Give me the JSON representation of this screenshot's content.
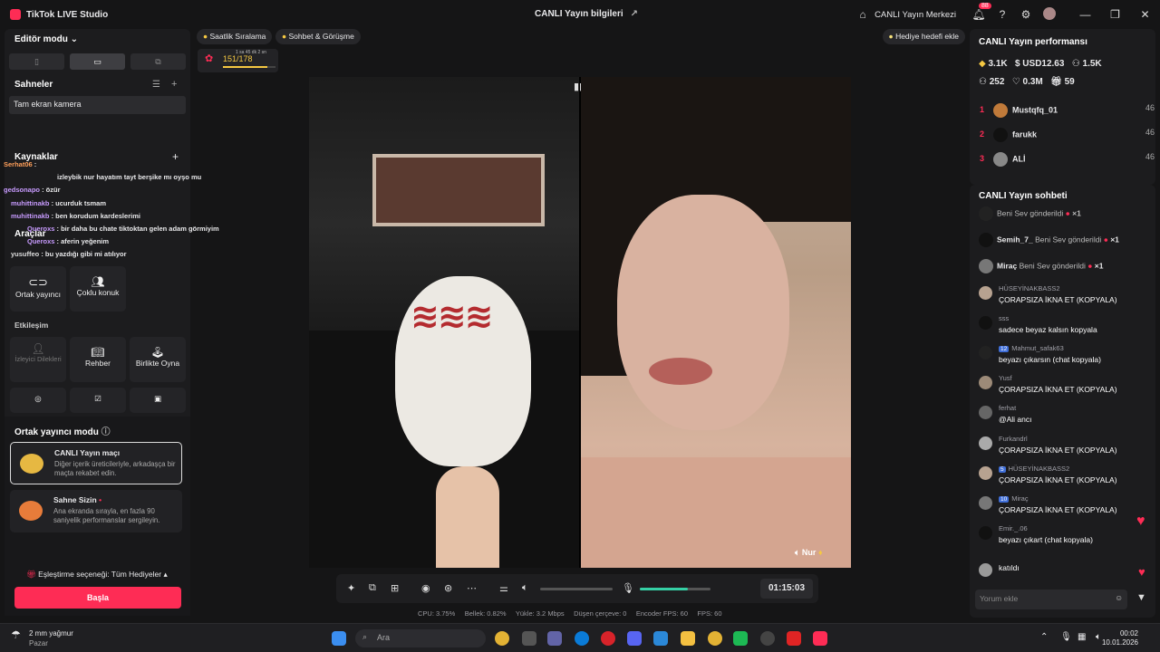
{
  "titlebar": {
    "app_title": "TikTok LIVE Studio",
    "center_title": "CANLI Yayın bilgileri",
    "live_center": "CANLI Yayın Merkezi",
    "notif_count": "88"
  },
  "left": {
    "editor_mode": "Editör modu",
    "scenes_title": "Sahneler",
    "scene_item": "Tam ekran kamera",
    "sources_title": "Kaynaklar",
    "tools_title": "Araçlar",
    "tools": [
      "Ortak yayıncı",
      "Çoklu konuk"
    ],
    "interaction_title": "Etkileşim",
    "interaction": [
      "İzleyici Dilekleri",
      "Rehber",
      "Birlikte Oyna"
    ],
    "overlay_chat": [
      {
        "u": "Serhat06",
        "t": " :  "
      },
      {
        "u": "",
        "t": "izleybik nur hayatım tayt berşike mı oyşo mu"
      },
      {
        "u": "gedsonapo",
        "t": " : özür"
      },
      {
        "u": "muhittinakb",
        "t": " : ucurduk tsmam"
      },
      {
        "u": "muhittinakb",
        "t": " : ben korudum kardeslerimi"
      },
      {
        "u": "Queroxs",
        "t": " : bir daha bu chate tiktoktan gelen adam görmiyim"
      },
      {
        "u": "Queroxs",
        "t": " : aferin yeğenim"
      },
      {
        "u": "yusuffeo",
        "t": " : bu yazdığı gibi mi atılıyor"
      }
    ],
    "cohost_title": "Ortak yayıncı modu",
    "cards": [
      {
        "title": "CANLI Yayın maçı",
        "desc": "Diğer içerik üreticileriyle, arkadaşça bir maçta rekabet edin."
      },
      {
        "title": "Sahne Sizin",
        "desc": "Ana ekranda sırayla, en fazla 90 saniyelik performanslar sergileyin."
      }
    ],
    "match_option": "Eşleştirme seçeneği: Tüm Hediyeler",
    "start_button": "Başla"
  },
  "center": {
    "chip_ranking": "Saatlik Sıralama",
    "chip_chat": "Sohbet & Görüşme",
    "gift_goal": "Hediye hedefi ekle",
    "goal_progress": "151/178",
    "goal_time": "1 sa 45 dk 2 sn",
    "guest_name": "Nur",
    "timer": "01:15:03",
    "stats": {
      "cpu": "CPU:  3.75%",
      "mem": "Bellek:  0.82%",
      "load": "Yükle:  3.2 Mbps",
      "drop": "Düşen çerçeve:  0",
      "enc": "Encoder FPS:  60",
      "fps": "FPS:  60"
    }
  },
  "right": {
    "perf_title": "CANLI Yayın performansı",
    "metrics": [
      "3.1K",
      "USD12.63",
      "1.5K",
      "252",
      "0.3M",
      "59"
    ],
    "ranking": [
      {
        "n": "1",
        "name": "Mustqfq_01",
        "c": "46"
      },
      {
        "n": "2",
        "name": "farukk",
        "c": "46"
      },
      {
        "n": "3",
        "name": "ALİ",
        "c": "46"
      }
    ],
    "chat_title": "CANLI Yayın sohbeti",
    "gifts": [
      {
        "u": "",
        "t": "Beni Sev gönderildi",
        "x": "×1"
      },
      {
        "u": "Semih_7_",
        "t": "Beni Sev gönderildi",
        "x": "×1"
      },
      {
        "u": "Miraç",
        "t": "Beni Sev gönderildi",
        "x": "×1"
      }
    ],
    "messages": [
      {
        "u": "HÜSEYİNAKBASS2",
        "t": "ÇORAPSIZA İKNA ET (KOPYALA)"
      },
      {
        "u": "sss",
        "t": "sadece beyaz kalsın kopyala"
      },
      {
        "u": "Mahmut_safak63",
        "lvl": "12",
        "t": "beyazı çıkarsın (chat kopyala)"
      },
      {
        "u": "Yusf",
        "t": "ÇORAPSIZA İKNA ET (KOPYALA)"
      },
      {
        "u": "ferhat",
        "t": "@Ali ancı"
      },
      {
        "u": "Furkandrl",
        "t": "ÇORAPSIZA İKNA ET (KOPYALA)"
      },
      {
        "u": "HÜSEYİNAKBASS2",
        "lvl": "5",
        "t": "ÇORAPSIZA İKNA ET (KOPYALA)"
      },
      {
        "u": "Miraç",
        "lvl": "10",
        "t": "ÇORAPSIZA İKNA ET (KOPYALA)"
      },
      {
        "u": "Emir._.06",
        "t": "beyazı çıkart (chat kopyala)"
      }
    ],
    "joined": "katıldı",
    "comment_placeholder": "Yorum ekle"
  },
  "taskbar": {
    "weather": "2 mm yağmur",
    "weather_sub": "Pazar",
    "search": "Ara",
    "time": "00:02",
    "date": "10.01.2026"
  }
}
